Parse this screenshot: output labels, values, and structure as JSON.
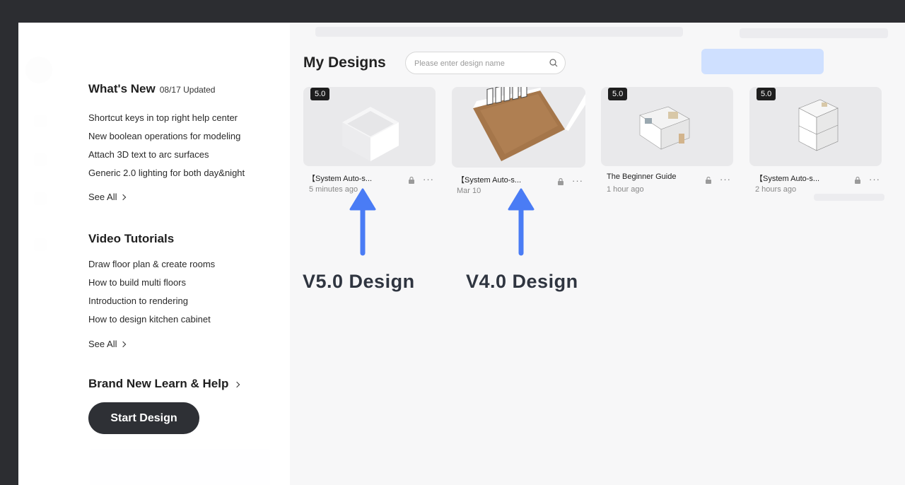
{
  "whats_new": {
    "title": "What's New",
    "updated": "08/17 Updated",
    "items": [
      "Shortcut keys in top right help center",
      "New boolean operations for modeling",
      "Attach 3D text to arc surfaces",
      "Generic 2.0 lighting for both day&night"
    ],
    "see_all": "See All"
  },
  "video_tutorials": {
    "title": "Video Tutorials",
    "items": [
      "Draw floor plan & create rooms",
      "How to build multi floors",
      "Introduction to rendering",
      "How to design kitchen cabinet"
    ],
    "see_all": "See All"
  },
  "learn_help": {
    "title": "Brand New Learn & Help"
  },
  "start_button": {
    "label": "Start Design"
  },
  "my_designs": {
    "title": "My Designs",
    "search_placeholder": "Please enter design name",
    "cards": [
      {
        "badge": "5.0",
        "name": "【System Auto-s...",
        "time": "5 minutes ago",
        "locked": true
      },
      {
        "badge": "",
        "name": "【System Auto-s...",
        "time": "Mar 10",
        "locked": true
      },
      {
        "badge": "5.0",
        "name": "The Beginner Guide",
        "time": "1 hour ago",
        "locked": false
      },
      {
        "badge": "5.0",
        "name": "【System Auto-s...",
        "time": "2 hours ago",
        "locked": true
      }
    ]
  },
  "annotations": {
    "left": "V5.0 Design",
    "right": "V4.0 Design",
    "arrow_color": "#4a7cf5"
  }
}
